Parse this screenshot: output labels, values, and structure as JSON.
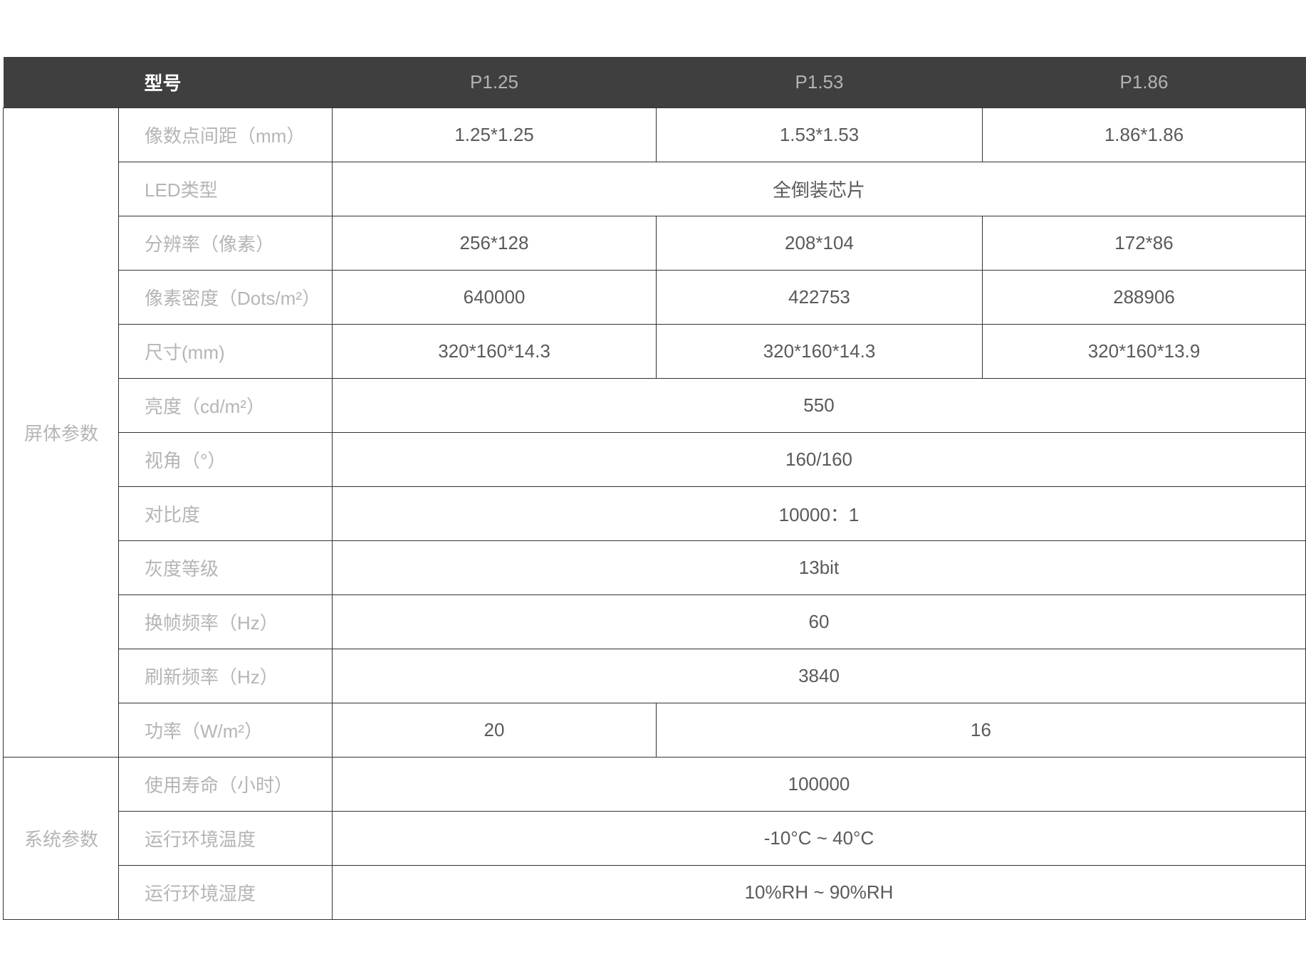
{
  "header": {
    "label": "型号",
    "models": [
      "P1.25",
      "P1.53",
      "P1.86"
    ]
  },
  "groups": {
    "screen": "屏体参数",
    "system": "系统参数"
  },
  "rows": {
    "pixel_pitch": {
      "label": "像数点间距（mm）",
      "values": [
        "1.25*1.25",
        "1.53*1.53",
        "1.86*1.86"
      ]
    },
    "led_type": {
      "label": "LED类型",
      "value": "全倒装芯片"
    },
    "resolution": {
      "label": "分辨率（像素）",
      "values": [
        "256*128",
        "208*104",
        "172*86"
      ]
    },
    "pixel_density": {
      "label": "像素密度（Dots/m²）",
      "values": [
        "640000",
        "422753",
        "288906"
      ]
    },
    "size": {
      "label": "尺寸(mm)",
      "values": [
        "320*160*14.3",
        "320*160*14.3",
        "320*160*13.9"
      ]
    },
    "brightness": {
      "label": "亮度（cd/m²）",
      "value": "550"
    },
    "view_angle": {
      "label": "视角（°）",
      "value": "160/160"
    },
    "contrast": {
      "label": "对比度",
      "value": "10000：1"
    },
    "gray_level": {
      "label": "灰度等级",
      "value": "13bit"
    },
    "frame_rate": {
      "label": "换帧频率（Hz）",
      "value": "60"
    },
    "refresh_rate": {
      "label": "刷新频率（Hz）",
      "value": "3840"
    },
    "power": {
      "label": "功率（W/m²）",
      "values": [
        "20",
        "16"
      ]
    },
    "lifetime": {
      "label": "使用寿命（小时）",
      "value": "100000"
    },
    "op_temp": {
      "label": "运行环境温度",
      "value": "-10°C ~ 40°C"
    },
    "op_humidity": {
      "label": "运行环境湿度",
      "value": "10%RH ~ 90%RH"
    }
  }
}
